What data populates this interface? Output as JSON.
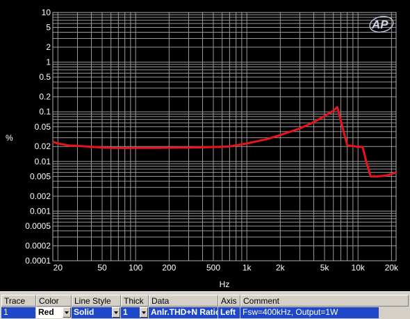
{
  "chart_data": {
    "type": "line",
    "xlabel": "Hz",
    "ylabel": "%",
    "x_scale": "log",
    "y_scale": "log",
    "xlim": [
      18,
      22000
    ],
    "ylim": [
      0.0001,
      10
    ],
    "grid": true,
    "y_ticks": [
      {
        "value": 10,
        "label": "10"
      },
      {
        "value": 5,
        "label": "5"
      },
      {
        "value": 2,
        "label": "2"
      },
      {
        "value": 1,
        "label": "1"
      },
      {
        "value": 0.5,
        "label": "0.5"
      },
      {
        "value": 0.2,
        "label": "0.2"
      },
      {
        "value": 0.1,
        "label": "0.1"
      },
      {
        "value": 0.05,
        "label": "0.05"
      },
      {
        "value": 0.02,
        "label": "0.02"
      },
      {
        "value": 0.01,
        "label": "0.01"
      },
      {
        "value": 0.005,
        "label": "0.005"
      },
      {
        "value": 0.002,
        "label": "0.002"
      },
      {
        "value": 0.001,
        "label": "0.001"
      },
      {
        "value": 0.0005,
        "label": "0.0005"
      },
      {
        "value": 0.0002,
        "label": "0.0002"
      },
      {
        "value": 0.0001,
        "label": "0.0001"
      }
    ],
    "x_ticks": [
      {
        "value": 20,
        "label": "20"
      },
      {
        "value": 50,
        "label": "50"
      },
      {
        "value": 100,
        "label": "100"
      },
      {
        "value": 200,
        "label": "200"
      },
      {
        "value": 500,
        "label": "500"
      },
      {
        "value": 1000,
        "label": "1k"
      },
      {
        "value": 2000,
        "label": "2k"
      },
      {
        "value": 5000,
        "label": "5k"
      },
      {
        "value": 10000,
        "label": "10k"
      },
      {
        "value": 20000,
        "label": "20k"
      }
    ],
    "series": [
      {
        "color": "#e8141c",
        "x": [
          18,
          20,
          25,
          30,
          40,
          50,
          60,
          80,
          100,
          150,
          200,
          300,
          400,
          500,
          700,
          1000,
          1500,
          2000,
          3000,
          4000,
          5000,
          6000,
          6500,
          8000,
          9000,
          9500,
          11000,
          12000,
          13000,
          15000,
          18000,
          22000
        ],
        "y": [
          0.025,
          0.023,
          0.021,
          0.0205,
          0.0198,
          0.019,
          0.0187,
          0.0186,
          0.0187,
          0.0188,
          0.0189,
          0.019,
          0.0192,
          0.0195,
          0.02,
          0.023,
          0.028,
          0.034,
          0.046,
          0.062,
          0.082,
          0.105,
          0.125,
          0.021,
          0.0205,
          0.02,
          0.0195,
          0.009,
          0.005,
          0.005,
          0.0052,
          0.006
        ]
      }
    ]
  },
  "logo": {
    "text": "AP"
  },
  "trace_table": {
    "headers": [
      "Trace",
      "Color",
      "Line Style",
      "Thick",
      "Data",
      "Axis",
      "Comment"
    ],
    "row": {
      "trace": "1",
      "color": "Red",
      "line_style": "Solid",
      "thick": "1",
      "data": "Anlr.THD+N Ratio",
      "axis": "Left",
      "comment": "Fsw=400kHz, Output=1W"
    }
  }
}
